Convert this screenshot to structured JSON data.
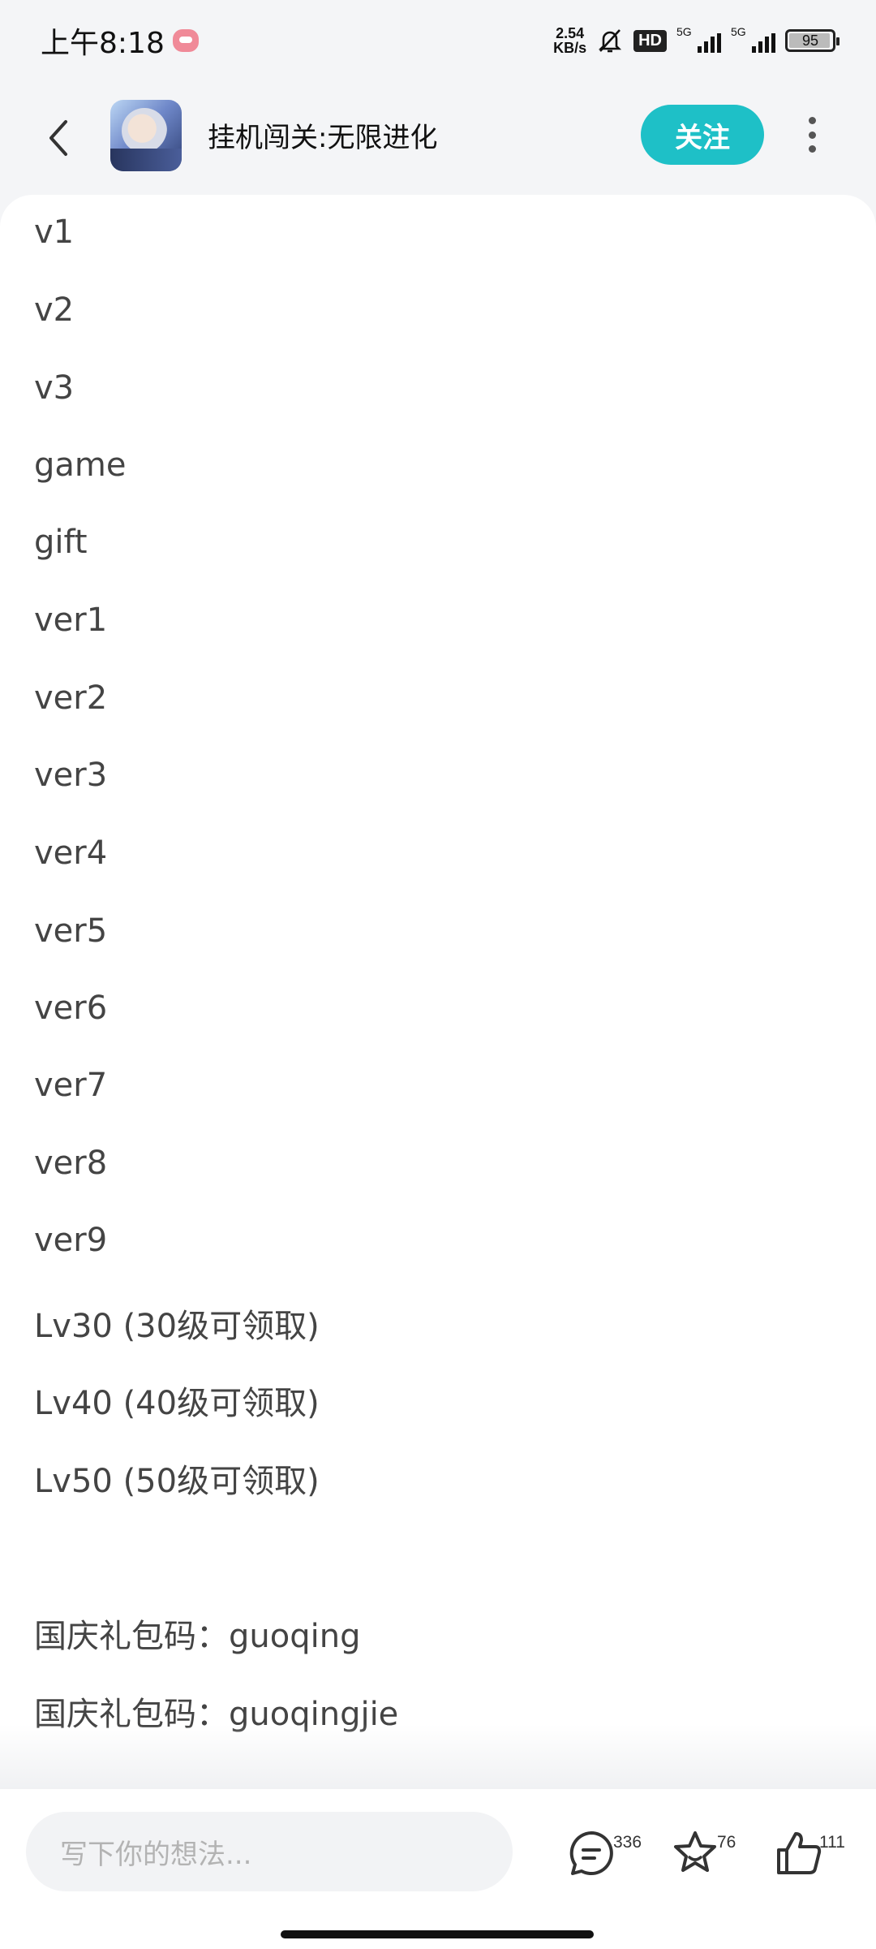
{
  "status_bar": {
    "time": "上午8:18",
    "net_speed_value": "2.54",
    "net_speed_unit": "KB/s",
    "hd_label": "HD",
    "signal1_label": "5G",
    "signal2_label": "5G",
    "battery": "95"
  },
  "header": {
    "title": "挂机闯关:无限进化",
    "follow_label": "关注"
  },
  "content": {
    "lines": [
      "v1",
      "v2",
      "v3",
      "game",
      "gift",
      "ver1",
      "ver2",
      "ver3",
      "ver4",
      "ver5",
      "ver6",
      "ver7",
      "ver8",
      "ver9",
      "Lv30 (30级可领取)",
      "Lv40 (40级可领取)",
      "Lv50 (50级可领取)",
      "",
      "国庆礼包码：guoqing",
      "国庆礼包码：guoqingjie"
    ]
  },
  "bottom_bar": {
    "comment_placeholder": "写下你的想法...",
    "comment_count": "336",
    "favorite_count": "76",
    "like_count": "111"
  },
  "icons": {
    "back": "chevron-left-icon",
    "more": "more-vertical-icon",
    "comment": "comment-icon",
    "favorite": "star-icon",
    "like": "thumbs-up-icon"
  },
  "colors": {
    "accent": "#1ec0c7",
    "background": "#f4f5f7"
  }
}
